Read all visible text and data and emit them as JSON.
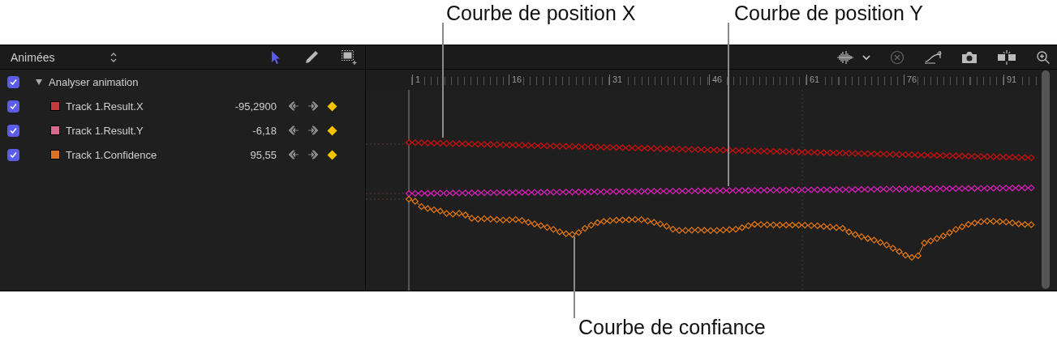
{
  "callouts": [
    {
      "label": "Courbe de position X"
    },
    {
      "label": "Courbe de position Y"
    },
    {
      "label": "Courbe de confiance"
    }
  ],
  "list_header": {
    "filter": "Animées",
    "tools": [
      {
        "kind": "arrow",
        "selected": true
      },
      {
        "kind": "pencil",
        "selected": false
      },
      {
        "kind": "marquee",
        "selected": false
      }
    ]
  },
  "group": {
    "label": "Analyser animation",
    "checked": true,
    "expanded": true,
    "children": [
      {
        "name": "Track 1.Result.X",
        "value": "-95,2900",
        "color": "#c0393b",
        "checked": true
      },
      {
        "name": "Track 1.Result.Y",
        "value": "-6,18",
        "color": "#d56a8c",
        "checked": true
      },
      {
        "name": "Track 1.Confidence",
        "value": "95,55",
        "color": "#dc7322",
        "checked": true
      }
    ]
  },
  "ruler": {
    "labels": [
      "1",
      "16",
      "31",
      "46",
      "61",
      "76",
      "91"
    ]
  }
}
